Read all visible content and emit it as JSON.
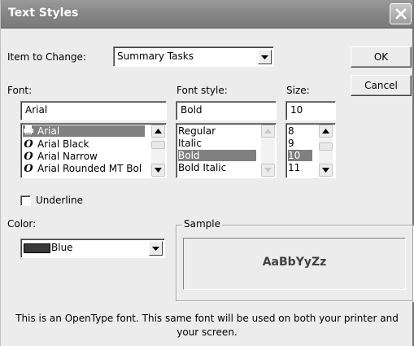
{
  "window": {
    "title": "Text Styles"
  },
  "item_to_change": {
    "label": "Item to Change:",
    "value": "Summary Tasks"
  },
  "buttons": {
    "ok": "OK",
    "cancel": "Cancel"
  },
  "font": {
    "label": "Font:",
    "value": "Arial",
    "items": [
      {
        "label": "Arial",
        "icon": "printer-font-icon",
        "selected": true
      },
      {
        "label": "Arial Black",
        "icon": "opentype-icon",
        "selected": false
      },
      {
        "label": "Arial Narrow",
        "icon": "opentype-icon",
        "selected": false
      },
      {
        "label": "Arial Rounded MT Bol",
        "icon": "opentype-icon",
        "selected": false
      }
    ]
  },
  "font_style": {
    "label": "Font style:",
    "value": "Bold",
    "items": [
      {
        "label": "Regular",
        "selected": false
      },
      {
        "label": "Italic",
        "selected": false
      },
      {
        "label": "Bold",
        "selected": true
      },
      {
        "label": "Bold Italic",
        "selected": false
      }
    ]
  },
  "size": {
    "label": "Size:",
    "value": "10",
    "items": [
      {
        "label": "8",
        "selected": false
      },
      {
        "label": "9",
        "selected": false
      },
      {
        "label": "10",
        "selected": true
      },
      {
        "label": "11",
        "selected": false
      }
    ]
  },
  "underline": {
    "label": "Underline",
    "checked": false
  },
  "color": {
    "label": "Color:",
    "value": "Blue",
    "swatch": "#3a3a3a"
  },
  "sample": {
    "label": "Sample",
    "text": "AaBbYyZz"
  },
  "description": {
    "line1": "This is an OpenType font. This same font will be used on both your printer and",
    "line2": "your screen."
  },
  "colors": {
    "selection": "#808080",
    "dialog_bg": "#ececec",
    "titlebar": "#858585"
  }
}
